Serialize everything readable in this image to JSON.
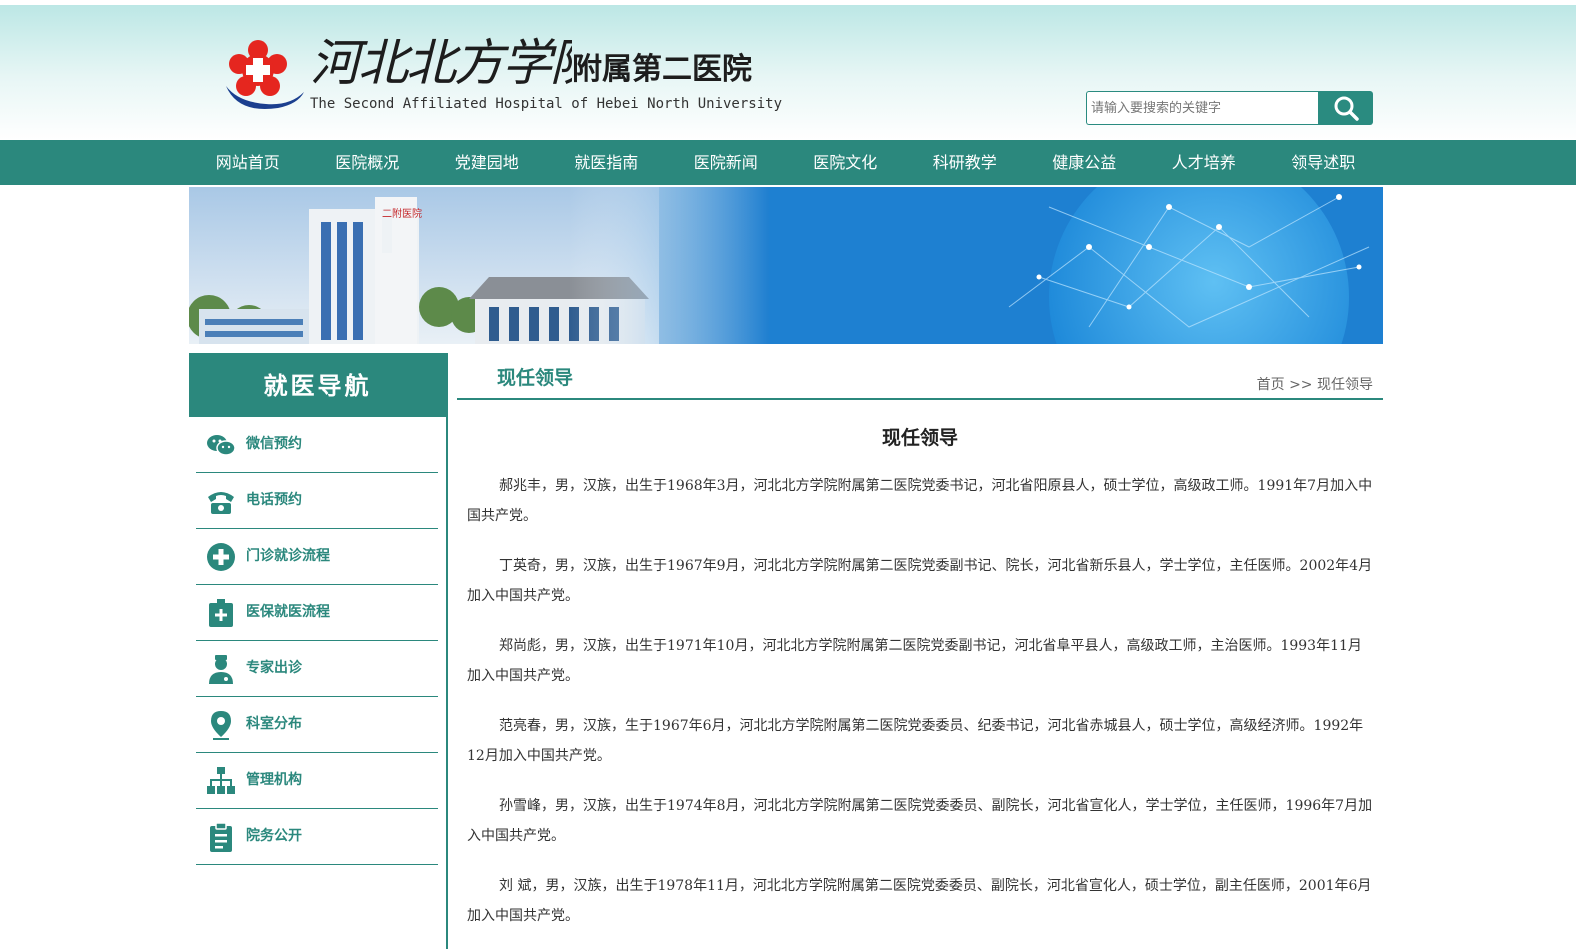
{
  "header": {
    "logo_cn_script": "河北北方学院",
    "logo_cn_name": "附属第二医院",
    "logo_en": "The Second Affiliated Hospital of Hebei North University",
    "search_placeholder": "请输入要搜索的关键字",
    "search_icon": "search-icon"
  },
  "nav": {
    "items": [
      "网站首页",
      "医院概况",
      "党建园地",
      "就医指南",
      "医院新闻",
      "医院文化",
      "科研教学",
      "健康公益",
      "人才培养",
      "领导述职"
    ]
  },
  "banner": {
    "building_sign": "二附医院"
  },
  "sidebar": {
    "title": "就医导航",
    "items": [
      {
        "label": "微信预约",
        "icon": "wechat-icon"
      },
      {
        "label": "电话预约",
        "icon": "phone-icon"
      },
      {
        "label": "门诊就诊流程",
        "icon": "medical-cross-icon"
      },
      {
        "label": "医保就医流程",
        "icon": "medical-kit-icon"
      },
      {
        "label": "专家出诊",
        "icon": "doctor-icon"
      },
      {
        "label": "科室分布",
        "icon": "location-pin-icon"
      },
      {
        "label": "管理机构",
        "icon": "org-chart-icon"
      },
      {
        "label": "院务公开",
        "icon": "clipboard-icon"
      }
    ]
  },
  "main": {
    "section_title": "现任领导",
    "breadcrumb": {
      "home": "首页",
      "separator": ">>",
      "current": "现任领导"
    },
    "article_title": "现任领导",
    "paragraphs": [
      "郝兆丰，男，汉族，出生于1968年3月，河北北方学院附属第二医院党委书记，河北省阳原县人，硕士学位，高级政工师。1991年7月加入中国共产党。",
      "丁英奇，男，汉族，出生于1967年9月，河北北方学院附属第二医院党委副书记、院长，河北省新乐县人，学士学位，主任医师。2002年4月加入中国共产党。",
      "郑尚彪，男，汉族，出生于1971年10月，河北北方学院附属第二医院党委副书记，河北省阜平县人，高级政工师，主治医师。1993年11月加入中国共产党。",
      "范亮春，男，汉族，生于1967年6月，河北北方学院附属第二医院党委委员、纪委书记，河北省赤城县人，硕士学位，高级经济师。1992年12月加入中国共产党。",
      "孙雪峰，男，汉族，出生于1974年8月，河北北方学院附属第二医院党委委员、副院长，河北省宣化人，学士学位，主任医师，1996年7月加入中国共产党。",
      "刘 斌，男，汉族，出生于1978年11月，河北北方学院附属第二医院党委委员、副院长，河北省宣化人，硕士学位，副主任医师，2001年6月加入中国共产党。"
    ]
  },
  "colors": {
    "primary": "#2b887d",
    "header_bg": "#b9e6e4",
    "text": "#333333"
  }
}
